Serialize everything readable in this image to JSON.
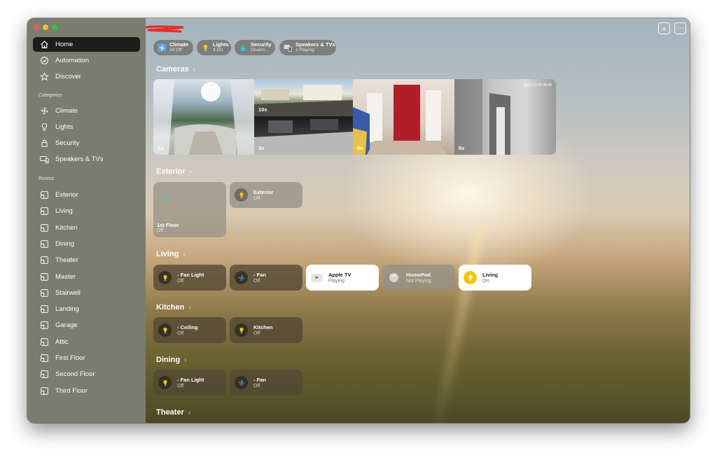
{
  "sidebar": {
    "nav": [
      {
        "label": "Home",
        "icon": "house-icon",
        "active": true
      },
      {
        "label": "Automation",
        "icon": "clock-check-icon"
      },
      {
        "label": "Discover",
        "icon": "star-icon"
      }
    ],
    "categories_heading": "Categories",
    "categories": [
      {
        "label": "Climate",
        "icon": "fan-icon"
      },
      {
        "label": "Lights",
        "icon": "lightbulb-icon"
      },
      {
        "label": "Security",
        "icon": "lock-icon"
      },
      {
        "label": "Speakers & TVs",
        "icon": "tv-speaker-icon"
      }
    ],
    "rooms_heading": "Rooms",
    "rooms": [
      {
        "label": "Exterior"
      },
      {
        "label": "Living"
      },
      {
        "label": "Kitchen"
      },
      {
        "label": "Dining"
      },
      {
        "label": "Theater"
      },
      {
        "label": "Master"
      },
      {
        "label": "Stairwell"
      },
      {
        "label": "Landing"
      },
      {
        "label": "Garage"
      },
      {
        "label": "Attic"
      },
      {
        "label": "First Floor"
      },
      {
        "label": "Second Floor"
      },
      {
        "label": "Third Floor"
      }
    ]
  },
  "toolbar": {
    "add_label": "+",
    "more_label": "⋯"
  },
  "status_pills": [
    {
      "title": "Climate",
      "subtitle": "All Off",
      "icon": "fan-icon",
      "color": "#5aa9e6"
    },
    {
      "title": "Lights",
      "subtitle": "4 On",
      "icon": "lightbulb-icon",
      "color": "#f5c518"
    },
    {
      "title": "Security",
      "subtitle": "Disarm...",
      "icon": "lock-icon",
      "color": "#36c8d0"
    },
    {
      "title": "Speakers & TVs",
      "subtitle": "1 Playing",
      "icon": "tv-speaker-icon",
      "color": "#d8d8d8"
    }
  ],
  "cameras": {
    "title": "Cameras",
    "feeds": [
      {
        "label": "1s"
      },
      {
        "label": "10s"
      },
      {
        "label": "3s"
      },
      {
        "label": "8s"
      },
      {
        "label": "6s",
        "timestamp": "2024-10-26 05:45"
      }
    ]
  },
  "exterior": {
    "title": "Exterior",
    "big_tile": {
      "name": "1st Floor",
      "state": "Off"
    },
    "tiles": [
      {
        "name": "Exterior",
        "state": "Off"
      }
    ]
  },
  "living": {
    "title": "Living",
    "tiles": [
      {
        "name": "- Fan Light",
        "state": "Off"
      },
      {
        "name": "- Fan",
        "state": "Off"
      },
      {
        "name": "Apple TV",
        "state": "Playing",
        "icon_text": "tv"
      },
      {
        "name": "HomePod",
        "state": "Not Playing"
      },
      {
        "name": "Living",
        "state": "On"
      }
    ]
  },
  "kitchen": {
    "title": "Kitchen",
    "tiles": [
      {
        "name": "- Ceiling",
        "state": "Off"
      },
      {
        "name": "Kitchen",
        "state": "Off"
      }
    ]
  },
  "dining": {
    "title": "Dining",
    "tiles": [
      {
        "name": "- Fan Light",
        "state": "Off"
      },
      {
        "name": "- Fan",
        "state": "Off"
      }
    ]
  },
  "theater": {
    "title": "Theater"
  },
  "colors": {
    "sidebar": "#7a7c70",
    "active_nav": "#1d1e1a",
    "bulb_yellow": "#f5c518",
    "fan_blue": "#5aa9e6"
  }
}
